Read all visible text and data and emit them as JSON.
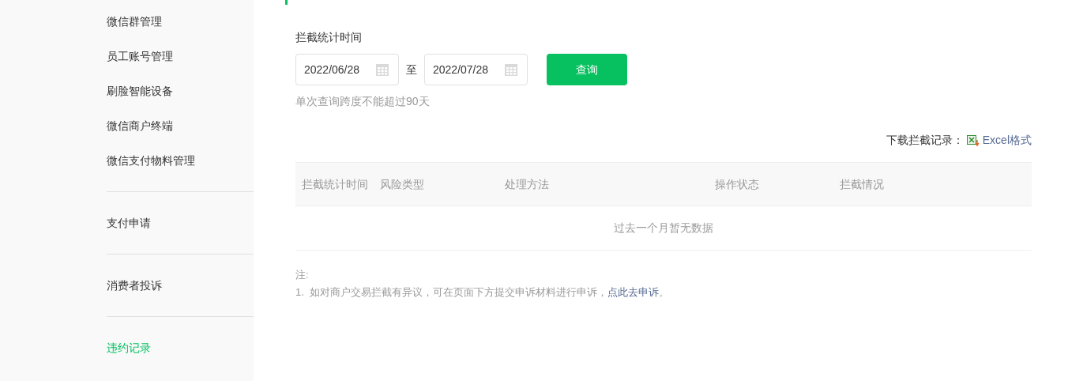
{
  "sidebar": {
    "groups": [
      {
        "items": [
          {
            "label": "微信群管理",
            "selected": false
          },
          {
            "label": "员工账号管理",
            "selected": false
          },
          {
            "label": "刷脸智能设备",
            "selected": false
          },
          {
            "label": "微信商户终端",
            "selected": false
          },
          {
            "label": "微信支付物料管理",
            "selected": false
          }
        ]
      },
      {
        "items": [
          {
            "label": "支付申请",
            "selected": false
          }
        ]
      },
      {
        "items": [
          {
            "label": "消费者投诉",
            "selected": false
          }
        ]
      },
      {
        "items": [
          {
            "label": "违约记录",
            "selected": true
          }
        ]
      }
    ]
  },
  "filter": {
    "label": "拦截统计时间",
    "start_date": "2022/06/28",
    "separator": "至",
    "end_date": "2022/07/28",
    "button": "查询",
    "hint": "单次查询跨度不能超过90天"
  },
  "download": {
    "label": "下载拦截记录：",
    "link": "Excel格式"
  },
  "table": {
    "columns": [
      "拦截统计时间",
      "风险类型",
      "处理方法",
      "操作状态",
      "拦截情况"
    ],
    "empty_text": "过去一个月暂无数据"
  },
  "notes": {
    "title": "注:",
    "items": [
      {
        "number": "1.",
        "text": "如对商户交易拦截有异议，可在页面下方提交申诉材料进行申诉，",
        "link": "点此去申诉",
        "end": "。"
      }
    ]
  }
}
